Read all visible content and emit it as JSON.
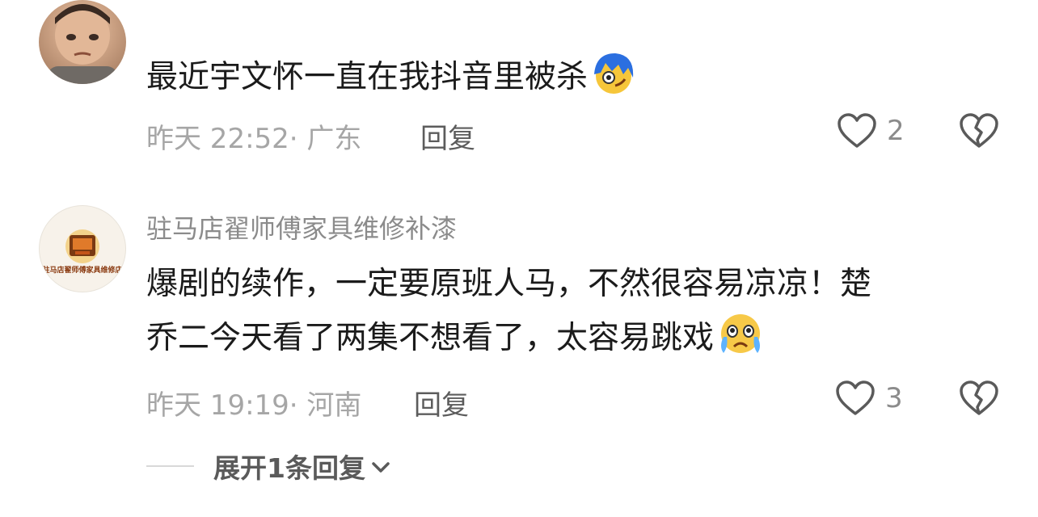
{
  "comments": [
    {
      "avatar_icon": "child-avatar",
      "username": "",
      "text": "最近宇文怀一直在我抖音里被杀",
      "emoji": "blue-hair-smirk-emoji",
      "time": "昨天 22:52",
      "location": "广东",
      "meta": "昨天 22:52· 广东",
      "reply_label": "回复",
      "likes": "2"
    },
    {
      "avatar_icon": "furniture-shop-logo-avatar",
      "avatar_text": "驻马店翟师傅家具维修店",
      "username": "驻马店翟师傅家具维修补漆",
      "text_line1": "爆剧的续作，一定要原班人马，不然很容易凉凉！楚",
      "text_line2": "乔二今天看了两集不想看了，太容易跳戏",
      "emoji": "crying-face-emoji",
      "time": "昨天 19:19",
      "location": "河南",
      "meta": "昨天 19:19· 河南",
      "reply_label": "回复",
      "likes": "3"
    }
  ],
  "expand_replies": {
    "label": "展开1条回复"
  },
  "colors": {
    "text_primary": "#1b1b1b",
    "text_secondary": "#a6a6a6",
    "username": "#8b8b8b",
    "icon_stroke": "#5a5a5a"
  }
}
